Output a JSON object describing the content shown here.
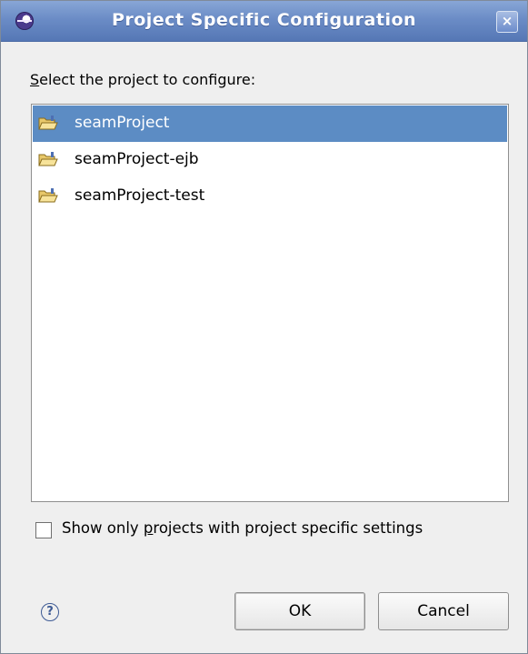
{
  "window": {
    "title": "Project Specific Configuration",
    "close_label": "×"
  },
  "prompt": {
    "mnemonic": "S",
    "rest": "elect the project to configure:"
  },
  "projects": [
    {
      "name": "seamProject",
      "selected": true,
      "icon": "project-folder-icon"
    },
    {
      "name": "seamProject-ejb",
      "selected": false,
      "icon": "project-folder-icon"
    },
    {
      "name": "seamProject-test",
      "selected": false,
      "icon": "project-folder-icon"
    }
  ],
  "filter_checkbox": {
    "checked": false,
    "label_before": "Show only ",
    "label_mnemonic": "p",
    "label_after": "rojects with project specific settings"
  },
  "buttons": {
    "help_glyph": "?",
    "ok_label": "OK",
    "cancel_label": "Cancel"
  },
  "colors": {
    "selection": "#5c8cc4",
    "titlebar": "#6b8cc6"
  }
}
